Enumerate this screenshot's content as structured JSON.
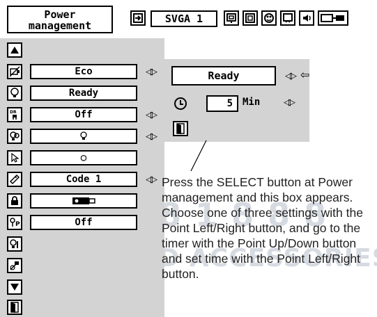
{
  "header": {
    "title_line1": "Power",
    "title_line2": "management",
    "mode": "SVGA 1",
    "icons": [
      "input-icon",
      "image-icon",
      "picture-icon",
      "color-icon",
      "screen-icon",
      "sound-icon",
      "setting-icon"
    ]
  },
  "menu": {
    "rows": [
      {
        "icon": "up-arrow-icon"
      },
      {
        "icon": "eco-icon",
        "value": "Eco"
      },
      {
        "icon": "power-management-icon",
        "value": "Ready"
      },
      {
        "icon": "direct-on-icon",
        "value": "Off"
      },
      {
        "icon": "lamp-icon",
        "value": "💡"
      },
      {
        "icon": "pointer-icon",
        "value": "○"
      },
      {
        "icon": "remote-control-icon",
        "value": "Code 1"
      },
      {
        "icon": "key-lock-icon",
        "value": ""
      },
      {
        "icon": "pin-code-icon",
        "value": "Off"
      },
      {
        "icon": "filter-icon"
      },
      {
        "icon": "lamp-counter-icon"
      },
      {
        "icon": "down-arrow-icon"
      },
      {
        "icon": "exit-icon"
      }
    ]
  },
  "submenu": {
    "mode_value": "Ready",
    "timer_value": "5",
    "timer_unit": "Min"
  },
  "description": "Press the SELECT button at Power management and this box appears. Choose one of three settings with the Point Left/Right button, and go to the timer with the Point Up/Down button and set time with the Point Left/Right button.",
  "watermark": {
    "line1": "m (800) 8 1 8 8 8",
    "line2": "LAMPS AND ACCESSORIES"
  }
}
